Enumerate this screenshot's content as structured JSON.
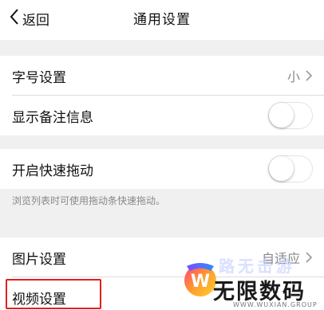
{
  "nav": {
    "back_label": "返回",
    "title": "通用设置"
  },
  "rows": {
    "font_size": {
      "label": "字号设置",
      "value": "小"
    },
    "show_remark": {
      "label": "显示备注信息",
      "on": false
    },
    "quick_drag": {
      "label": "开启快速拖动",
      "on": false
    },
    "quick_drag_hint": "浏览列表时可使用拖动条快速拖动。",
    "image": {
      "label": "图片设置",
      "value": "自适应"
    },
    "video": {
      "label": "视频设置"
    }
  },
  "watermark": {
    "brand": "无限数码",
    "ghost": "路无击游",
    "url": "WWW.WUXIAN.GROUP"
  },
  "colors": {
    "highlight": "#e02020",
    "page_bg": "#f0f0f0"
  }
}
